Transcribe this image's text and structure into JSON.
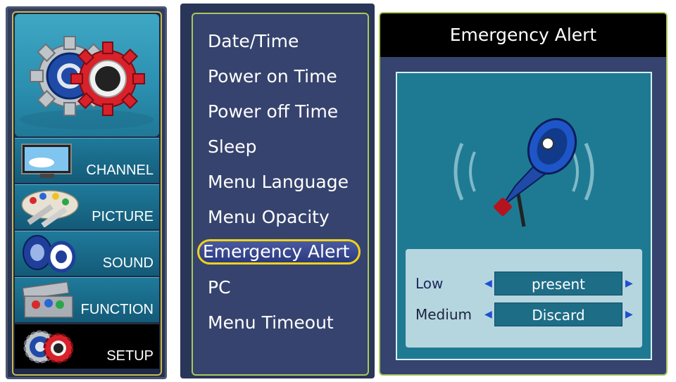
{
  "sidebar": {
    "categories": [
      {
        "label": "CHANNEL",
        "icon": "tv-icon"
      },
      {
        "label": "PICTURE",
        "icon": "palette-icon"
      },
      {
        "label": "SOUND",
        "icon": "speakers-icon"
      },
      {
        "label": "FUNCTION",
        "icon": "toolbox-icon"
      },
      {
        "label": "SETUP",
        "icon": "gears-icon",
        "selected": true
      }
    ]
  },
  "menu": {
    "items": [
      {
        "label": "Date/Time"
      },
      {
        "label": "Power on Time"
      },
      {
        "label": "Power off Time"
      },
      {
        "label": "Sleep"
      },
      {
        "label": "Menu Language"
      },
      {
        "label": "Menu Opacity"
      },
      {
        "label": "Emergency Alert",
        "selected": true
      },
      {
        "label": "PC"
      },
      {
        "label": "Menu Timeout"
      }
    ]
  },
  "panel": {
    "title": "Emergency Alert",
    "icon": "megaphone-icon",
    "options": [
      {
        "name": "Low",
        "value": "present"
      },
      {
        "name": "Medium",
        "value": "Discard"
      }
    ]
  },
  "colors": {
    "highlight_border": "#f0d21a",
    "frame_border": "#a8c95c",
    "menu_bg": "#36436e",
    "panel_bg": "#1e7a92"
  }
}
